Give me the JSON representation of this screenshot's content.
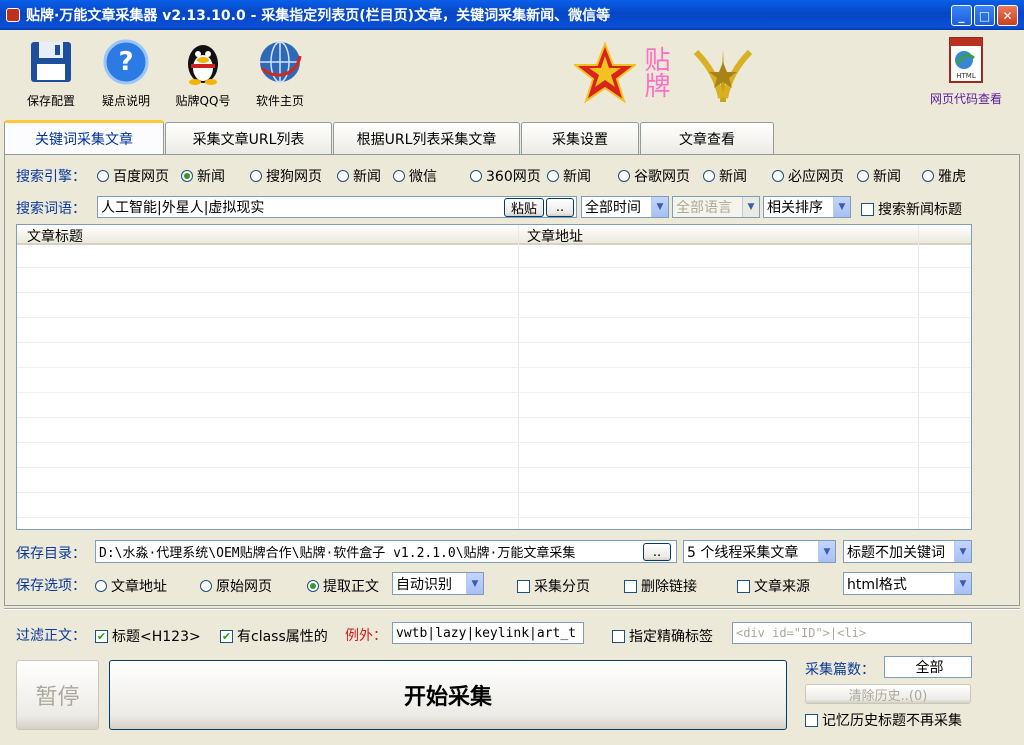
{
  "window": {
    "title": "贴牌·万能文章采集器 v2.13.10.0 - 采集指定列表页(栏目页)文章，关键词采集新闻、微信等",
    "min": "_",
    "max": "□",
    "close": "✕"
  },
  "toolbar": {
    "save": "保存配置",
    "help": "疑点说明",
    "qq": "贴牌QQ号",
    "home": "软件主页",
    "logo_text": "贴牌",
    "html_view": "网页代码查看",
    "html_label": "HTML"
  },
  "tabs": [
    "关键词采集文章",
    "采集文章URL列表",
    "根据URL列表采集文章",
    "采集设置",
    "文章查看"
  ],
  "engines": {
    "label": "搜索引擎：",
    "options": [
      "百度网页",
      "新闻",
      "搜狗网页",
      "新闻",
      "微信",
      "360网页",
      "新闻",
      "谷歌网页",
      "新闻",
      "必应网页",
      "新闻",
      "雅虎"
    ],
    "selected_index": 1
  },
  "search": {
    "label": "搜索词语：",
    "value": "人工智能|外星人|虚拟现实",
    "paste": "粘贴",
    "browse": "..",
    "time": "全部时间",
    "lang": "全部语言",
    "sort": "相关排序",
    "news_title": "搜索新闻标题"
  },
  "list": {
    "col1": "文章标题",
    "col2": "文章地址"
  },
  "save_dir": {
    "label": "保存目录：",
    "value": "D:\\水淼·代理系统\\OEM贴牌合作\\贴牌·软件盒子 v1.2.1.0\\贴牌·万能文章采集",
    "browse": "..",
    "threads": "5 个线程采集文章",
    "title_kw": "标题不加关键词"
  },
  "save_opts": {
    "label": "保存选项：",
    "opt1": "文章地址",
    "opt2": "原始网页",
    "opt3": "提取正文",
    "selected": "提取正文",
    "mode": "自动识别",
    "paging": "采集分页",
    "del_links": "删除链接",
    "source": "文章来源",
    "format": "html格式"
  },
  "filter": {
    "label": "过滤正文：",
    "h123": "标题<H123>",
    "class_attr": "有class属性的",
    "except_label": "例外：",
    "except_value": "vwtb|lazy|keylink|art_t",
    "precise": "指定精确标签",
    "precise_placeholder": "<div id=\"ID\">|<li>"
  },
  "bottom": {
    "pause": "暂停",
    "start": "开始采集",
    "count_label": "采集篇数：",
    "count_value": "全部",
    "clear": "清除历史..(0)",
    "remember": "记忆历史标题不再采集"
  }
}
